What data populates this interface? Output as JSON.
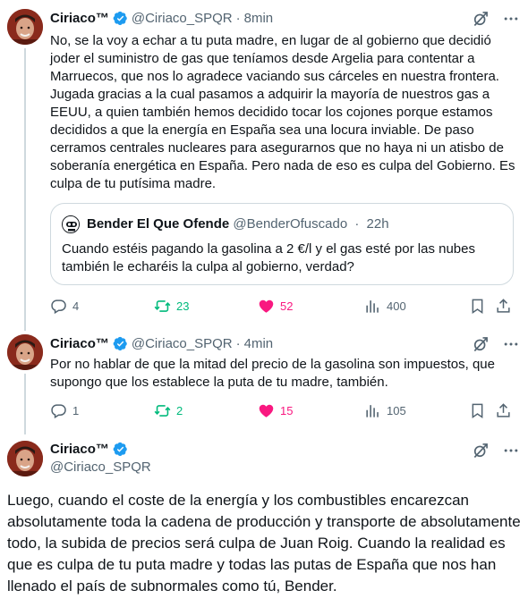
{
  "colors": {
    "verified": "#1d9bf0",
    "retweet": "#00ba7c",
    "like": "#f91880",
    "muted": "#536471"
  },
  "tweet1": {
    "name": "Ciriaco™",
    "handle": "@Ciriaco_SPQR",
    "sep": "·",
    "time": "8min",
    "text": "No, se la voy a echar a tu puta madre, en lugar de al gobierno que decidió joder el suministro de gas que teníamos desde Argelia para contentar a Marruecos, que nos lo agradece vaciando sus cárceles en nuestra frontera. Jugada gracias a la cual pasamos a adquirir la mayoría de nuestros gas a EEUU, a quien también hemos decidido tocar los cojones porque estamos decididos a que la energía en España sea una locura inviable. De paso cerramos centrales nucleares para asegurarnos que no haya ni un atisbo de soberanía energética en España. Pero nada de eso es culpa del Gobierno. Es culpa de tu putísima madre.",
    "quote": {
      "name": "Bender El Que Ofende",
      "handle": "@BenderOfuscado",
      "sep": "·",
      "time": "22h",
      "text": "Cuando estéis pagando la gasolina a 2 €/l y el gas esté por las nubes también le echaréis la culpa al gobierno, verdad?"
    },
    "replies": "4",
    "retweets": "23",
    "likes": "52",
    "views": "400"
  },
  "tweet2": {
    "name": "Ciriaco™",
    "handle": "@Ciriaco_SPQR",
    "sep": "·",
    "time": "4min",
    "text": "Por no hablar de que la mitad del precio de la gasolina son impuestos, que supongo que los establece la puta de tu madre, también.",
    "replies": "1",
    "retweets": "2",
    "likes": "15",
    "views": "105"
  },
  "tweet3": {
    "name": "Ciriaco™",
    "handle": "@Ciriaco_SPQR",
    "text": "Luego, cuando el coste de la energía y los combustibles encarezcan absolutamente toda la cadena de producción y transporte de absolutamente todo, la subida de precios será culpa de Juan Roig. Cuando la realidad es que es culpa de tu puta madre y todas las putas de España que nos han llenado el país de subnormales como tú, Bender."
  },
  "icons": {
    "verified": "verified-badge-icon",
    "grok": "grok-icon",
    "more": "more-icon",
    "reply": "reply-icon",
    "retweet": "retweet-icon",
    "like": "heart-icon",
    "views": "views-icon",
    "bookmark": "bookmark-icon",
    "share": "share-icon"
  }
}
